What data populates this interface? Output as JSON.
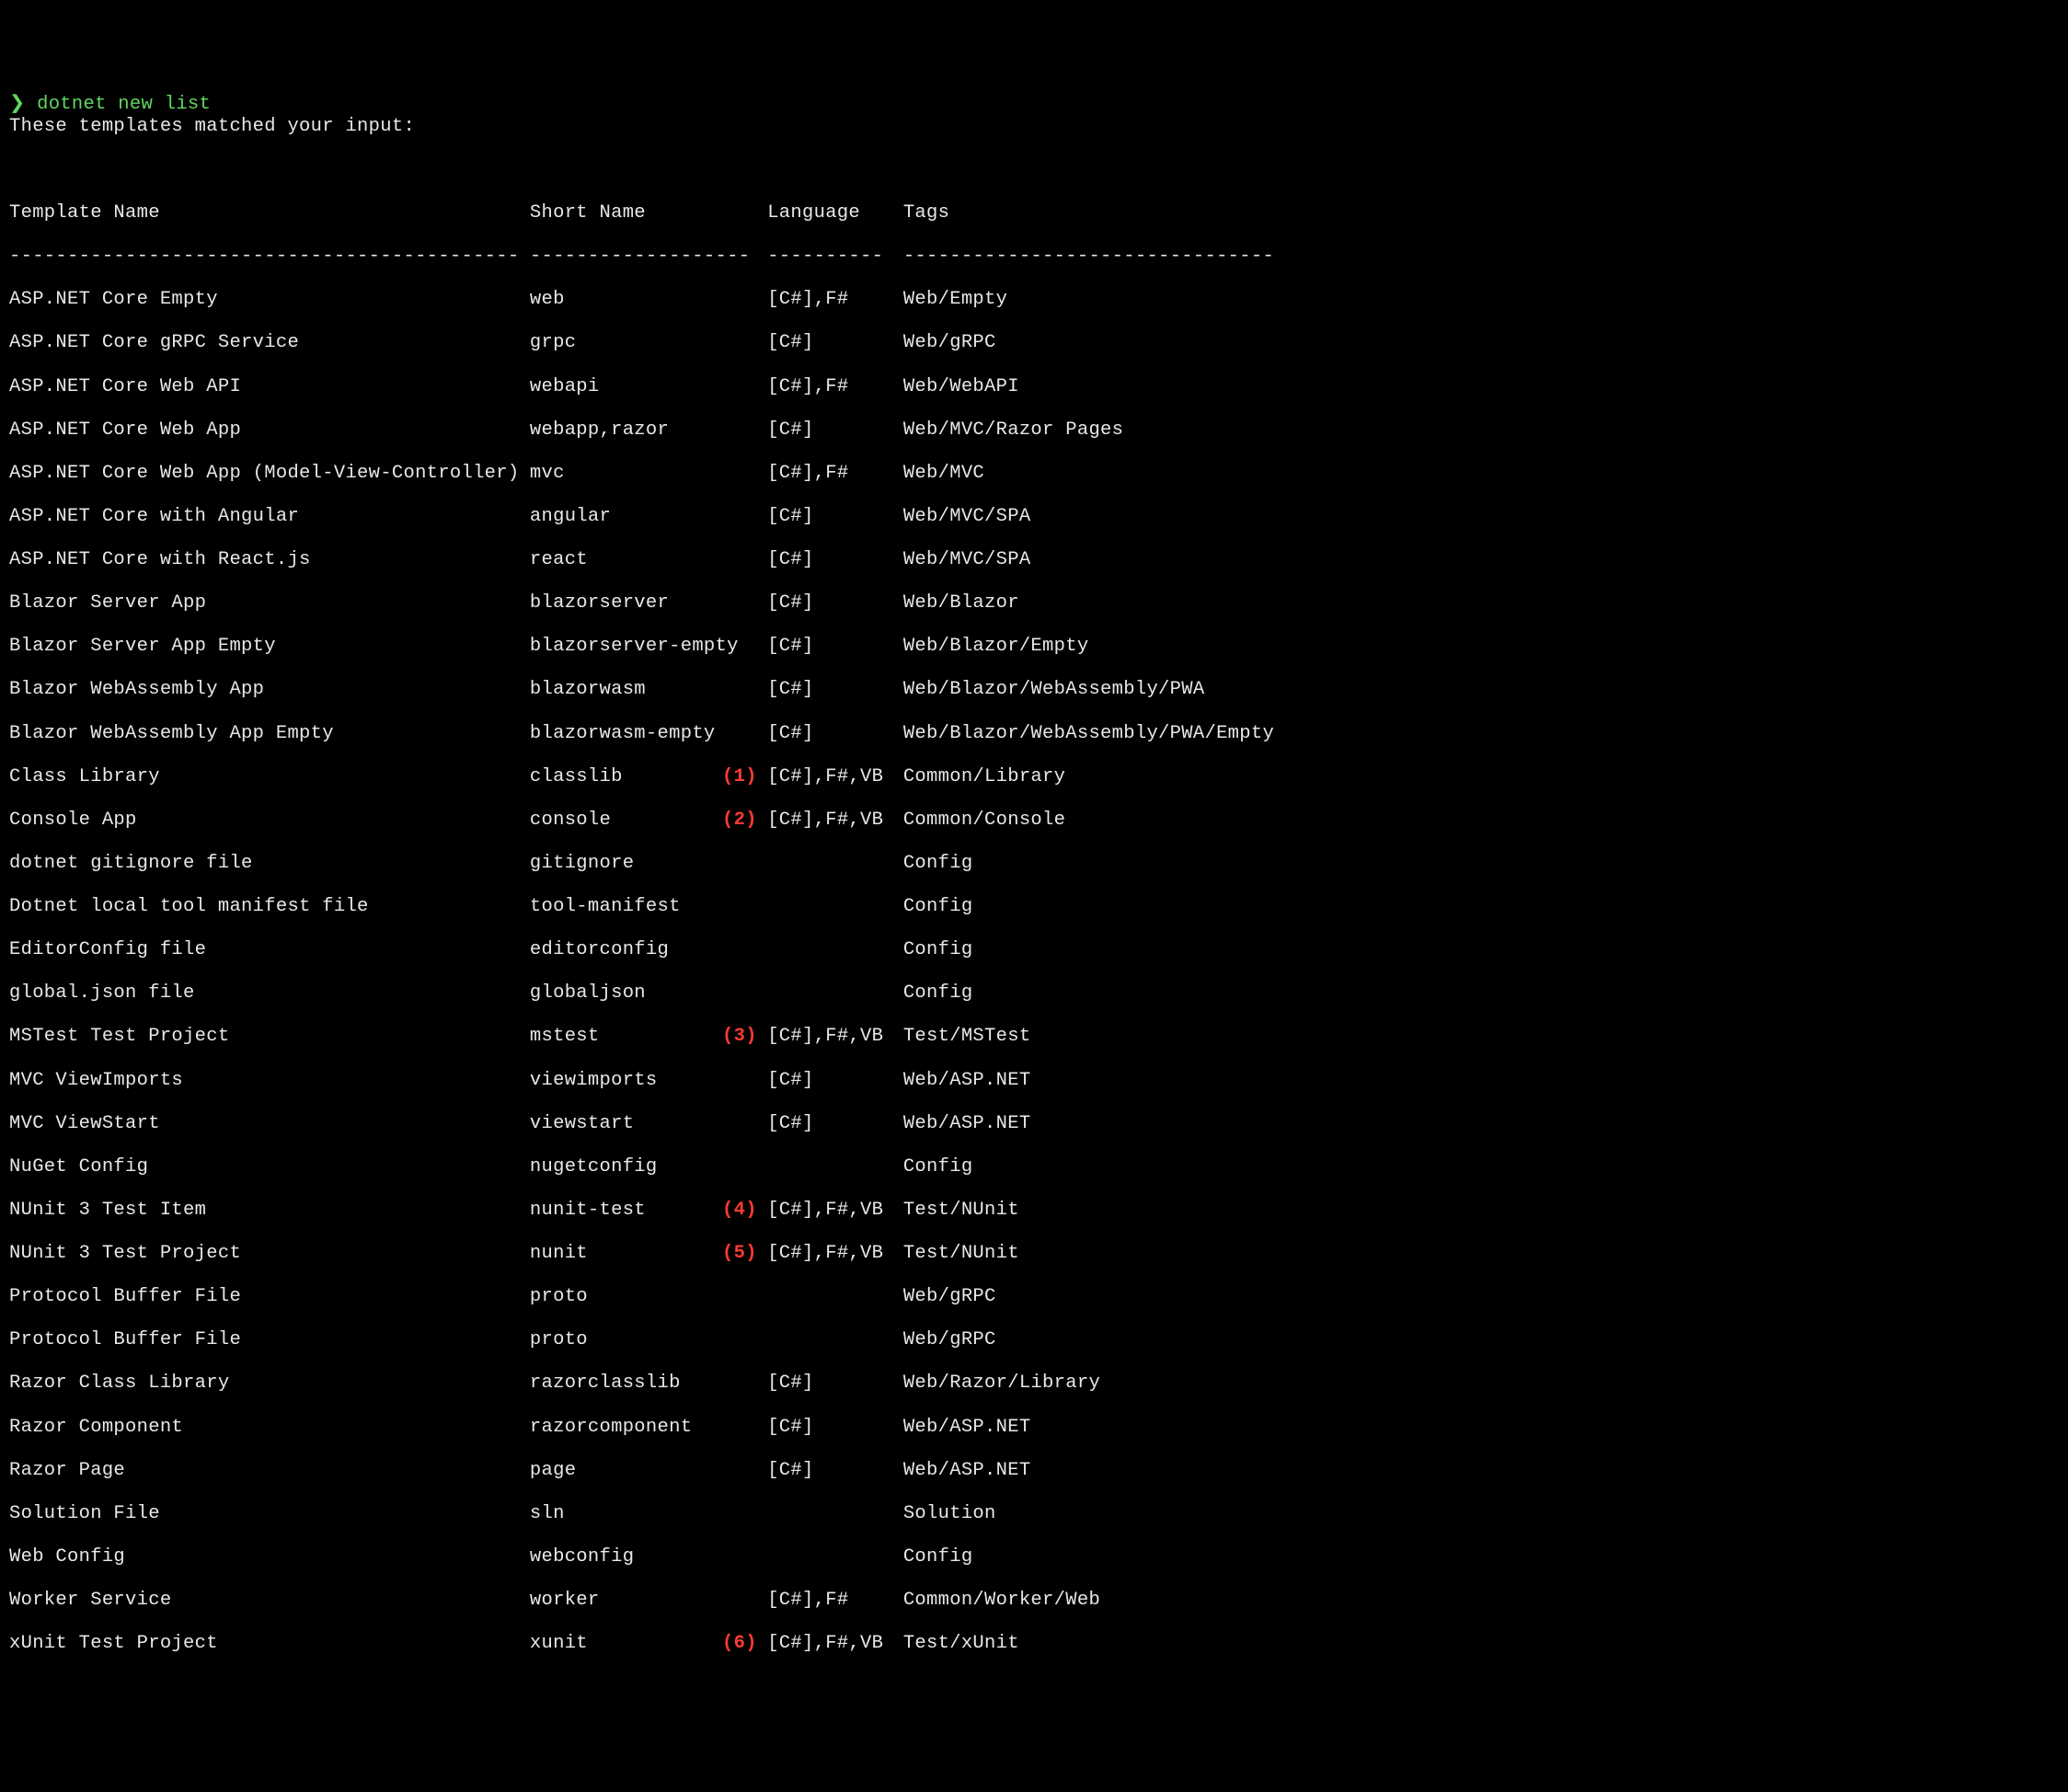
{
  "prompt_symbol": "❯",
  "command": "dotnet new list",
  "message": "These templates matched your input:",
  "headers": {
    "name": "Template Name",
    "short": "Short Name",
    "lang": "Language",
    "tags": "Tags"
  },
  "dividers": {
    "name": "--------------------------------------------",
    "short": "-------------------",
    "lang": "----------",
    "tags": "--------------------------------"
  },
  "rows": [
    {
      "name": "ASP.NET Core Empty",
      "short": "web",
      "anno": "",
      "lang": "[C#],F#",
      "tags": "Web/Empty"
    },
    {
      "name": "ASP.NET Core gRPC Service",
      "short": "grpc",
      "anno": "",
      "lang": "[C#]",
      "tags": "Web/gRPC"
    },
    {
      "name": "ASP.NET Core Web API",
      "short": "webapi",
      "anno": "",
      "lang": "[C#],F#",
      "tags": "Web/WebAPI"
    },
    {
      "name": "ASP.NET Core Web App",
      "short": "webapp,razor",
      "anno": "",
      "lang": "[C#]",
      "tags": "Web/MVC/Razor Pages"
    },
    {
      "name": "ASP.NET Core Web App (Model-View-Controller)",
      "short": "mvc",
      "anno": "",
      "lang": "[C#],F#",
      "tags": "Web/MVC"
    },
    {
      "name": "ASP.NET Core with Angular",
      "short": "angular",
      "anno": "",
      "lang": "[C#]",
      "tags": "Web/MVC/SPA"
    },
    {
      "name": "ASP.NET Core with React.js",
      "short": "react",
      "anno": "",
      "lang": "[C#]",
      "tags": "Web/MVC/SPA"
    },
    {
      "name": "Blazor Server App",
      "short": "blazorserver",
      "anno": "",
      "lang": "[C#]",
      "tags": "Web/Blazor"
    },
    {
      "name": "Blazor Server App Empty",
      "short": "blazorserver-empty",
      "anno": "",
      "lang": "[C#]",
      "tags": "Web/Blazor/Empty"
    },
    {
      "name": "Blazor WebAssembly App",
      "short": "blazorwasm",
      "anno": "",
      "lang": "[C#]",
      "tags": "Web/Blazor/WebAssembly/PWA"
    },
    {
      "name": "Blazor WebAssembly App Empty",
      "short": "blazorwasm-empty",
      "anno": "",
      "lang": "[C#]",
      "tags": "Web/Blazor/WebAssembly/PWA/Empty"
    },
    {
      "name": "Class Library",
      "short": "classlib",
      "anno": "(1)",
      "lang": "[C#],F#,VB",
      "tags": "Common/Library"
    },
    {
      "name": "Console App",
      "short": "console",
      "anno": "(2)",
      "lang": "[C#],F#,VB",
      "tags": "Common/Console"
    },
    {
      "name": "dotnet gitignore file",
      "short": "gitignore",
      "anno": "",
      "lang": "",
      "tags": "Config"
    },
    {
      "name": "Dotnet local tool manifest file",
      "short": "tool-manifest",
      "anno": "",
      "lang": "",
      "tags": "Config"
    },
    {
      "name": "EditorConfig file",
      "short": "editorconfig",
      "anno": "",
      "lang": "",
      "tags": "Config"
    },
    {
      "name": "global.json file",
      "short": "globaljson",
      "anno": "",
      "lang": "",
      "tags": "Config"
    },
    {
      "name": "MSTest Test Project",
      "short": "mstest",
      "anno": "(3)",
      "lang": "[C#],F#,VB",
      "tags": "Test/MSTest"
    },
    {
      "name": "MVC ViewImports",
      "short": "viewimports",
      "anno": "",
      "lang": "[C#]",
      "tags": "Web/ASP.NET"
    },
    {
      "name": "MVC ViewStart",
      "short": "viewstart",
      "anno": "",
      "lang": "[C#]",
      "tags": "Web/ASP.NET"
    },
    {
      "name": "NuGet Config",
      "short": "nugetconfig",
      "anno": "",
      "lang": "",
      "tags": "Config"
    },
    {
      "name": "NUnit 3 Test Item",
      "short": "nunit-test",
      "anno": "(4)",
      "lang": "[C#],F#,VB",
      "tags": "Test/NUnit"
    },
    {
      "name": "NUnit 3 Test Project",
      "short": "nunit",
      "anno": "(5)",
      "lang": "[C#],F#,VB",
      "tags": "Test/NUnit"
    },
    {
      "name": "Protocol Buffer File",
      "short": "proto",
      "anno": "",
      "lang": "",
      "tags": "Web/gRPC"
    },
    {
      "name": "Protocol Buffer File",
      "short": "proto",
      "anno": "",
      "lang": "",
      "tags": "Web/gRPC"
    },
    {
      "name": "Razor Class Library",
      "short": "razorclasslib",
      "anno": "",
      "lang": "[C#]",
      "tags": "Web/Razor/Library"
    },
    {
      "name": "Razor Component",
      "short": "razorcomponent",
      "anno": "",
      "lang": "[C#]",
      "tags": "Web/ASP.NET"
    },
    {
      "name": "Razor Page",
      "short": "page",
      "anno": "",
      "lang": "[C#]",
      "tags": "Web/ASP.NET"
    },
    {
      "name": "Solution File",
      "short": "sln",
      "anno": "",
      "lang": "",
      "tags": "Solution"
    },
    {
      "name": "Web Config",
      "short": "webconfig",
      "anno": "",
      "lang": "",
      "tags": "Config"
    },
    {
      "name": "Worker Service",
      "short": "worker",
      "anno": "",
      "lang": "[C#],F#",
      "tags": "Common/Worker/Web"
    },
    {
      "name": "xUnit Test Project",
      "short": "xunit",
      "anno": "(6)",
      "lang": "[C#],F#,VB",
      "tags": "Test/xUnit"
    }
  ]
}
